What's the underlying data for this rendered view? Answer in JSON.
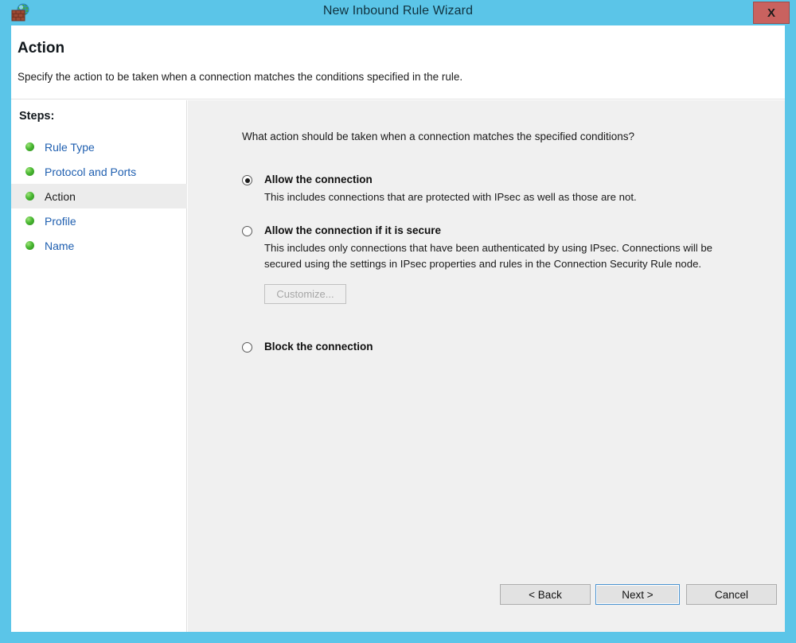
{
  "window": {
    "title": "New Inbound Rule Wizard",
    "app_icon": "firewall-brickwall-globe-icon",
    "close_label": "X",
    "frame_color": "#5bc5e8",
    "close_color": "#c9625f"
  },
  "header": {
    "title": "Action",
    "subtitle": "Specify the action to be taken when a connection matches the conditions specified in the rule."
  },
  "sidebar": {
    "heading": "Steps:",
    "items": [
      {
        "label": "Rule Type",
        "state": "completed"
      },
      {
        "label": "Protocol and Ports",
        "state": "completed"
      },
      {
        "label": "Action",
        "state": "current"
      },
      {
        "label": "Profile",
        "state": "completed"
      },
      {
        "label": "Name",
        "state": "completed"
      }
    ],
    "link_color": "#1f5fb0",
    "current_color": "#1b1b1b",
    "bullet_color": "#49b832"
  },
  "main": {
    "question": "What action should be taken when a connection matches the specified conditions?",
    "options": [
      {
        "title": "Allow the connection",
        "description": "This includes connections that are protected with IPsec as well as those are not.",
        "selected": true
      },
      {
        "title": "Allow the connection if it is secure",
        "description": "This includes only connections that have been authenticated by using IPsec.  Connections will be secured using the settings in IPsec properties and rules in the Connection Security Rule node.",
        "selected": false,
        "customize_label": "Customize...",
        "customize_enabled": false
      },
      {
        "title": "Block the connection",
        "description": "",
        "selected": false
      }
    ]
  },
  "footer": {
    "back_label": "< Back",
    "next_label": "Next >",
    "cancel_label": "Cancel",
    "default_button": "Next >"
  }
}
